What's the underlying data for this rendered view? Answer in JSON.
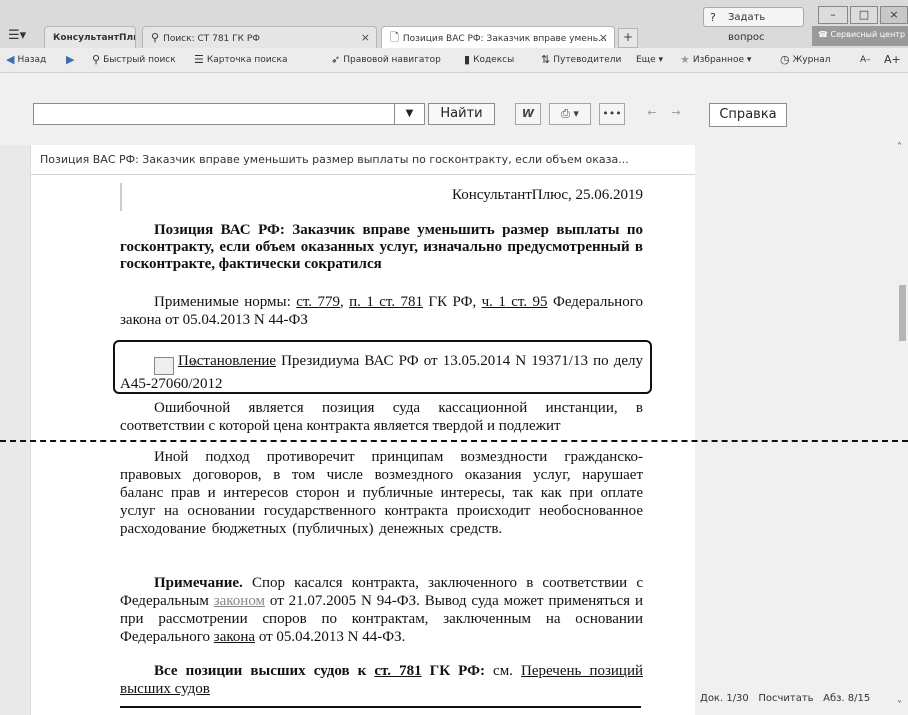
{
  "tabs": [
    {
      "label": "КонсультантПлюс"
    },
    {
      "label": "Поиск: СТ 781 ГК РФ",
      "close": "×"
    },
    {
      "label": "Позиция ВАС РФ: Заказчик вправе умень...",
      "close": "×"
    }
  ],
  "ask_question": "Задать вопрос",
  "service_center": "Сервисный центр",
  "toolbar": {
    "back": "Назад",
    "quick_search": "Быстрый поиск",
    "search_card": "Карточка поиска",
    "legal_navigator": "Правовой навигатор",
    "codes": "Кодексы",
    "guides": "Путеводители",
    "more": "Еще ▾",
    "favorites": "Избранное ▾",
    "journal": "Журнал",
    "font_minus": "А–",
    "font_plus": "А+"
  },
  "search": {
    "value": "",
    "find": "Найти",
    "help": "Справка"
  },
  "doc_header": "Позиция ВАС РФ: Заказчик вправе уменьшить размер выплаты по госконтракту, если объем оказа...",
  "document": {
    "source": "КонсультантПлюс, 25.06.2019",
    "title": "Позиция ВАС РФ: Заказчик вправе уменьшить размер выплаты по госконтракту, если объем оказанных услуг, изначально предусмотренный в госконтракте, фактически сократился",
    "norms_prefix": "Применимые нормы: ",
    "norm1": "ст. 779",
    "norm2": "п. 1 ст. 781",
    "norms_mid": " ГК РФ, ",
    "norm3": "ч. 1 ст. 95",
    "norms_suffix": "Федерального закона от 05.04.2013 N 44-ФЗ",
    "ruling_link": "Постановление",
    "ruling_text": " Президиума ВАС РФ от 13.05.2014 N 19371/13 по делу А45-27060/2012",
    "para1": "Ошибочной является позиция суда кассационной инстанции, в соответствии с которой цена контракта является твердой и подлежит",
    "para2": "Иной подход противоречит принципам возмездности гражданско-правовых договоров, в том числе возмездного оказания услуг, нарушает баланс прав и интересов сторон и публичные интересы, так как при оплате услуг на основании государственного контракта происходит необоснованное расходование бюджетных (публичных) денежных средств.",
    "note_label": "Примечание.",
    "note_a": " Спор касался контракта, заключенного в соответствии с Федеральным ",
    "note_link1": "законом",
    "note_b": " от 21.07.2005 N 94-ФЗ. Вывод суда может применяться и при рассмотрении споров по контрактам, заключенным на основании Федерального ",
    "note_link2": "закона",
    "note_c": " от 05.04.2013 N 44-ФЗ.",
    "all_positions_a": "Все позиции высших судов к ",
    "all_positions_link": "ст. 781",
    "all_positions_b": " ГК РФ:",
    "all_positions_c": " см. ",
    "all_positions_list": "Перечень позиций высших судов"
  },
  "status": {
    "doc": "Док. 1/30",
    "count": "Посчитать",
    "paragraph": "Абз. 8/15"
  }
}
